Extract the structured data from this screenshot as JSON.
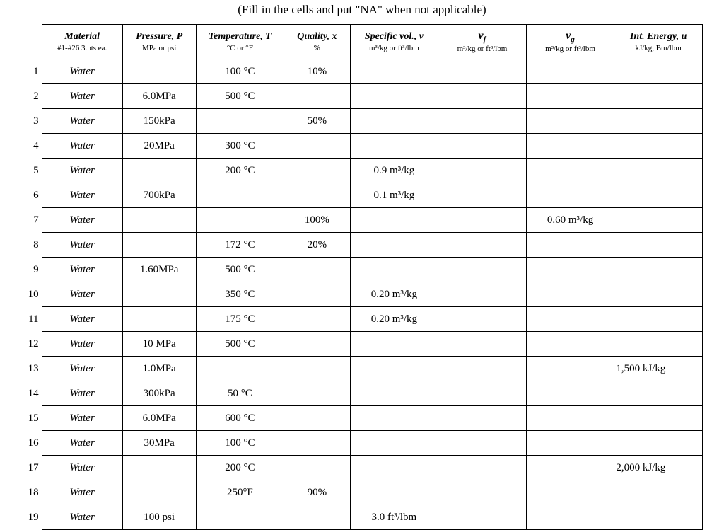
{
  "caption": "(Fill in the cells and put \"NA\" when not applicable)",
  "headers": {
    "material": {
      "main": "Material",
      "sub": "#1-#26  3.pts ea."
    },
    "pressure": {
      "main": "Pressure, P",
      "sub": "MPa  or  psi"
    },
    "temperature": {
      "main": "Temperature, T",
      "sub": "°C   or   °F"
    },
    "quality": {
      "main": "Quality, x",
      "sub": "%"
    },
    "spvol": {
      "main": "Specific vol., v",
      "sub": "m³/kg or ft³/lbm"
    },
    "vf": {
      "sym": "v",
      "subscript": "f",
      "sub": "m³/kg or ft³/lbm"
    },
    "vg": {
      "sym": "v",
      "subscript": "g",
      "sub": "m³/kg or ft³/lbm"
    },
    "energy": {
      "main": "Int. Energy, u",
      "sub": "kJ/kg,  Btu/lbm"
    }
  },
  "rows": [
    {
      "n": "1",
      "material": "Water",
      "pressure": "",
      "temperature": "100 °C",
      "quality": "10%",
      "spvol": "",
      "vf": "",
      "vg": "",
      "energy": ""
    },
    {
      "n": "2",
      "material": "Water",
      "pressure": "6.0MPa",
      "temperature": "500 °C",
      "quality": "",
      "spvol": "",
      "vf": "",
      "vg": "",
      "energy": ""
    },
    {
      "n": "3",
      "material": "Water",
      "pressure": "150kPa",
      "temperature": "",
      "quality": "50%",
      "spvol": "",
      "vf": "",
      "vg": "",
      "energy": ""
    },
    {
      "n": "4",
      "material": "Water",
      "pressure": "20MPa",
      "temperature": "300 °C",
      "quality": "",
      "spvol": "",
      "vf": "",
      "vg": "",
      "energy": ""
    },
    {
      "n": "5",
      "material": "Water",
      "pressure": "",
      "temperature": "200 °C",
      "quality": "",
      "spvol": "0.9 m³/kg",
      "vf": "",
      "vg": "",
      "energy": ""
    },
    {
      "n": "6",
      "material": "Water",
      "pressure": "700kPa",
      "temperature": "",
      "quality": "",
      "spvol": "0.1 m³/kg",
      "vf": "",
      "vg": "",
      "energy": ""
    },
    {
      "n": "7",
      "material": "Water",
      "pressure": "",
      "temperature": "",
      "quality": "100%",
      "spvol": "",
      "vf": "",
      "vg": "0.60 m³/kg",
      "energy": ""
    },
    {
      "n": "8",
      "material": "Water",
      "pressure": "",
      "temperature": "172 °C",
      "quality": "20%",
      "spvol": "",
      "vf": "",
      "vg": "",
      "energy": ""
    },
    {
      "n": "9",
      "material": "Water",
      "pressure": "1.60MPa",
      "temperature": "500 °C",
      "quality": "",
      "spvol": "",
      "vf": "",
      "vg": "",
      "energy": ""
    },
    {
      "n": "10",
      "material": "Water",
      "pressure": "",
      "temperature": "350 °C",
      "quality": "",
      "spvol": "0.20 m³/kg",
      "vf": "",
      "vg": "",
      "energy": ""
    },
    {
      "n": "11",
      "material": "Water",
      "pressure": "",
      "temperature": "175 °C",
      "quality": "",
      "spvol": "0.20 m³/kg",
      "vf": "",
      "vg": "",
      "energy": ""
    },
    {
      "n": "12",
      "material": "Water",
      "pressure": "10 MPa",
      "temperature": "500 °C",
      "quality": "",
      "spvol": "",
      "vf": "",
      "vg": "",
      "energy": ""
    },
    {
      "n": "13",
      "material": "Water",
      "pressure": "1.0MPa",
      "temperature": "",
      "quality": "",
      "spvol": "",
      "vf": "",
      "vg": "",
      "energy": "1,500 kJ/kg"
    },
    {
      "n": "14",
      "material": "Water",
      "pressure": "300kPa",
      "temperature": "50 °C",
      "quality": "",
      "spvol": "",
      "vf": "",
      "vg": "",
      "energy": ""
    },
    {
      "n": "15",
      "material": "Water",
      "pressure": "6.0MPa",
      "temperature": "600 °C",
      "quality": "",
      "spvol": "",
      "vf": "",
      "vg": "",
      "energy": ""
    },
    {
      "n": "16",
      "material": "Water",
      "pressure": "30MPa",
      "temperature": "100 °C",
      "quality": "",
      "spvol": "",
      "vf": "",
      "vg": "",
      "energy": ""
    },
    {
      "n": "17",
      "material": "Water",
      "pressure": "",
      "temperature": "200 °C",
      "quality": "",
      "spvol": "",
      "vf": "",
      "vg": "",
      "energy": "2,000 kJ/kg"
    },
    {
      "n": "18",
      "material": "Water",
      "pressure": "",
      "temperature": "250°F",
      "quality": "90%",
      "spvol": "",
      "vf": "",
      "vg": "",
      "energy": ""
    },
    {
      "n": "19",
      "material": "Water",
      "pressure": "100 psi",
      "temperature": "",
      "quality": "",
      "spvol": "3.0 ft³/lbm",
      "vf": "",
      "vg": "",
      "energy": ""
    }
  ]
}
